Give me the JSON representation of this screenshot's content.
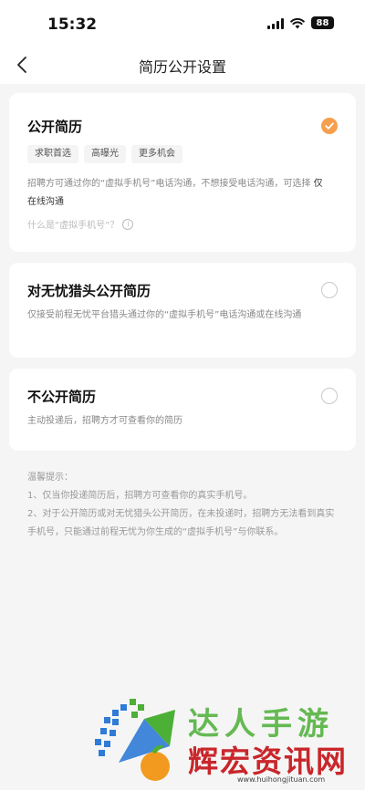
{
  "status_bar": {
    "time": "15:32",
    "battery": "88"
  },
  "nav": {
    "title": "简历公开设置"
  },
  "public_resume": {
    "title": "公开简历",
    "tags": [
      "求职首选",
      "高曝光",
      "更多机会"
    ],
    "desc_main": "招聘方可通过你的“虚拟手机号”电话沟通，不想接受电话沟通，可选择",
    "desc_option": "仅在线沟通",
    "help_text": "什么是“虚拟手机号”？",
    "selected": true
  },
  "headhunter_resume": {
    "title": "对无忧猎头公开简历",
    "desc": "仅接受前程无忧平台猎头通过你的“虚拟手机号”电话沟通或在线沟通",
    "selected": false
  },
  "private_resume": {
    "title": "不公开简历",
    "desc": "主动投递后，招聘方才可查看你的简历",
    "selected": false
  },
  "tips": {
    "heading": "温馨提示：",
    "items": [
      "1、仅当你投递简历后，招聘方可查看你的真实手机号。",
      "2、对于公开简历或对无忧猎头公开简历，在未投递时，招聘方无法看到真实手机号，只能通过前程无忧为你生成的“虚拟手机号”与你联系。"
    ]
  },
  "watermark": {
    "line1": "达人手游",
    "line2": "辉宏资讯网",
    "url": "www.huihongjituan.com"
  },
  "colors": {
    "accent": "#f5a04e",
    "background": "#f5f5f5"
  }
}
